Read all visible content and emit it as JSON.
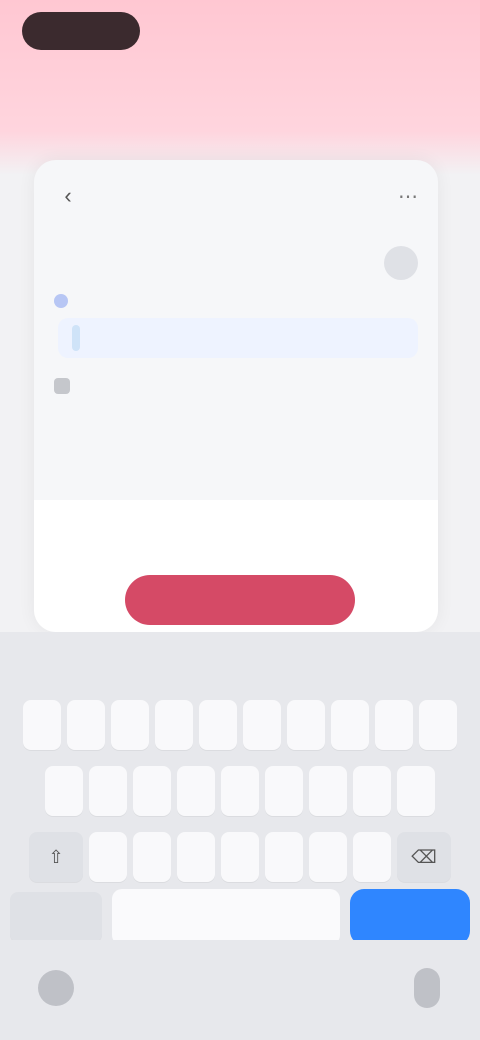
{
  "status": {
    "right_text": ""
  },
  "card": {
    "title": "",
    "section_title": "",
    "link_label": "",
    "selected_value": "",
    "option_label": "",
    "meta": [
      "",
      "",
      "",
      ""
    ],
    "hint": ""
  },
  "primary_button": {
    "label": ""
  },
  "keyboard": {
    "suggestions": [
      "",
      "",
      ""
    ],
    "row1": [
      "",
      "",
      "",
      "",
      "",
      "",
      "",
      "",
      "",
      ""
    ],
    "row2": [
      "",
      "",
      "",
      "",
      "",
      "",
      "",
      "",
      ""
    ],
    "row3": [
      "",
      "",
      "",
      "",
      "",
      "",
      "",
      ""
    ],
    "fn_label": "",
    "return_label": ""
  },
  "icons": {
    "back": "chevron-left-icon",
    "more": "more-icon",
    "globe": "globe-icon",
    "mic": "mic-icon"
  },
  "colors": {
    "header": "#ffc7d2",
    "primary": "#d54a66",
    "return_key": "#2f86ff"
  }
}
